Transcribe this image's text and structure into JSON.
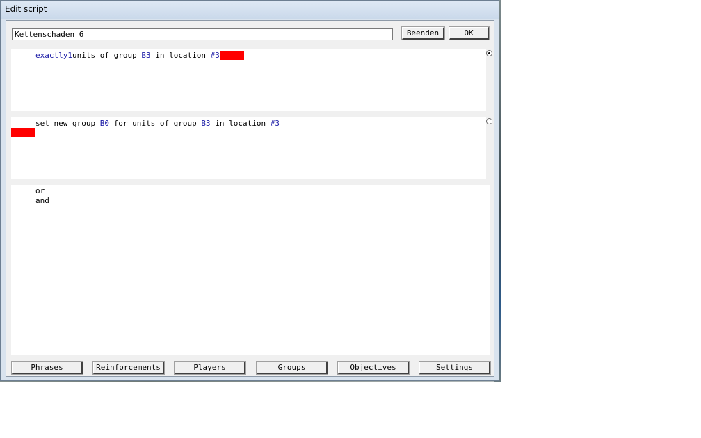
{
  "window": {
    "title": "Edit script"
  },
  "header": {
    "script_name": "Kettenschaden 6",
    "end_label": "Beenden",
    "ok_label": "OK"
  },
  "condition": {
    "kw1": "exactly1",
    "t1": "units of group ",
    "group": "B3",
    "t2": " in location ",
    "location": "#3"
  },
  "action": {
    "t1": "set new group ",
    "new_group": "B0",
    "t2": " for units of group ",
    "group": "B3",
    "t3": " in location ",
    "location": "#3"
  },
  "connectors": [
    "or",
    "and"
  ],
  "toolbar": {
    "buttons": [
      "Phrases",
      "Reinforcements",
      "Players",
      "Groups",
      "Objectives",
      "Settings"
    ]
  },
  "colors": {
    "keyword": "#1a1aa6",
    "missing_value": "#ff0000"
  }
}
